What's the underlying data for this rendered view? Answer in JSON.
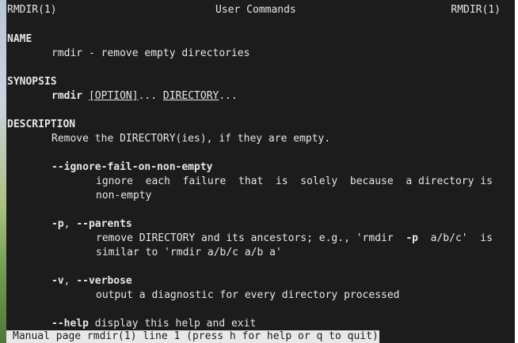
{
  "header": {
    "left": "RMDIR(1)",
    "center": "User Commands",
    "right": "RMDIR(1)"
  },
  "name": {
    "heading": "NAME",
    "text": "rmdir - remove empty directories"
  },
  "synopsis": {
    "heading": "SYNOPSIS",
    "command": "rmdir",
    "sep1": " ",
    "option": "[OPTION]",
    "sep2": "... ",
    "directory": "DIRECTORY",
    "ellipsis": "..."
  },
  "description": {
    "heading": "DESCRIPTION",
    "intro": "Remove the DIRECTORY(ies), if they are empty.",
    "options": [
      {
        "flag": "--ignore-fail-on-non-empty",
        "lines": [
          "ignore  each  failure  that  is  solely  because  a directory is",
          "non-empty"
        ]
      },
      {
        "flag_short": "-p",
        "flag_sep": ", ",
        "flag_long": "--parents",
        "line1_a": "remove DIRECTORY and its ancestors; e.g., 'rmdir  ",
        "line1_b": "-p",
        "line1_c": "  a/b/c'  is",
        "line2": "similar to 'rmdir a/b/c a/b a'"
      },
      {
        "flag_short": "-v",
        "flag_sep": ", ",
        "flag_long": "--verbose",
        "line1": "output a diagnostic for every directory processed"
      },
      {
        "flag": "--help",
        "text": " display this help and exit"
      }
    ]
  },
  "status_bar": {
    "text": "Manual page rmdir(1) line 1 (press h for help or q to quit)"
  }
}
